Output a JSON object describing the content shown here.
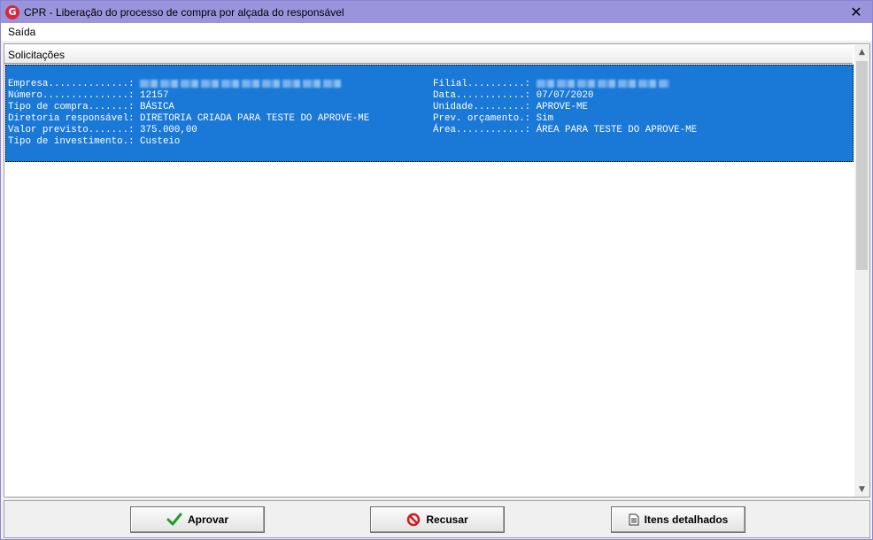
{
  "window": {
    "title": "CPR - Liberação do processo de compra por alçada do responsável",
    "app_icon": "G",
    "close_glyph": "✕"
  },
  "menu": {
    "items": [
      "Saída"
    ]
  },
  "panel": {
    "header": "Solicitações"
  },
  "record": {
    "left": [
      {
        "label": "Empresa..............:",
        "value": "",
        "redacted": true
      },
      {
        "label": "Número...............:",
        "value": "12157"
      },
      {
        "label": "Tipo de compra.......:",
        "value": "BÁSICA"
      },
      {
        "label": "Diretoria responsável:",
        "value": "DIRETORIA CRIADA PARA TESTE DO APROVE-ME"
      },
      {
        "label": "Valor previsto.......:",
        "value": "375.000,00"
      },
      {
        "label": "Tipo de investimento.:",
        "value": "Custeio"
      }
    ],
    "right": [
      {
        "label": "Filial..........:",
        "value": "",
        "redacted": true
      },
      {
        "label": "Data............:",
        "value": "07/07/2020"
      },
      {
        "label": "Unidade.........:",
        "value": "APROVE-ME"
      },
      {
        "label": "Prev. orçamento.:",
        "value": "Sim"
      },
      {
        "label": "Área............:",
        "value": "ÁREA PARA TESTE DO APROVE-ME"
      }
    ]
  },
  "buttons": {
    "approve": "Aprovar",
    "refuse": "Recusar",
    "items": "Itens detalhados"
  },
  "colors": {
    "titlebar": "#9a94dd",
    "selection": "#1a78d6",
    "approve_icon": "#1e9e2a",
    "refuse_icon": "#d01c1c"
  }
}
